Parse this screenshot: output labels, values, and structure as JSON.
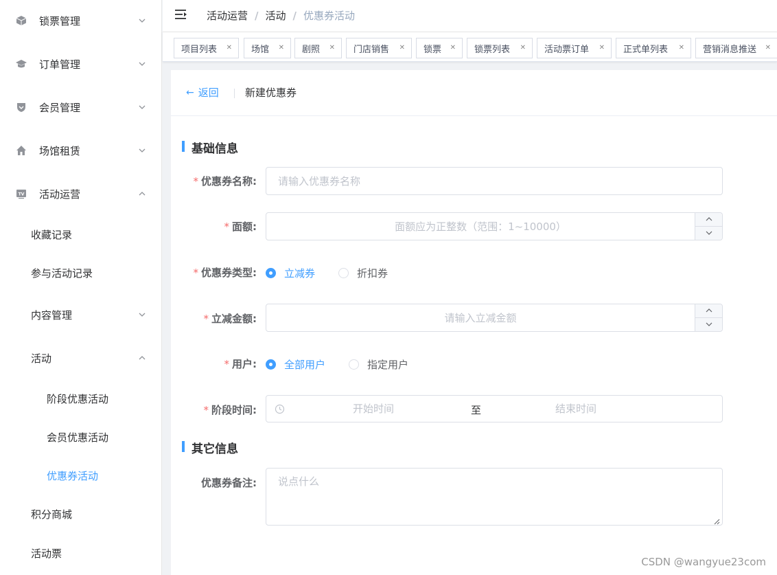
{
  "sidebar": {
    "items": [
      {
        "label": "锁票管理",
        "icon": "cube-icon",
        "expanded": false
      },
      {
        "label": "订单管理",
        "icon": "graduation-cap-icon",
        "expanded": false
      },
      {
        "label": "会员管理",
        "icon": "shield-icon",
        "expanded": false
      },
      {
        "label": "场馆租赁",
        "icon": "home-icon",
        "expanded": false
      },
      {
        "label": "活动运营",
        "icon": "tv-icon",
        "expanded": true
      },
      {
        "label": "收藏记录"
      },
      {
        "label": "参与活动记录"
      },
      {
        "label": "内容管理",
        "expanded": false
      },
      {
        "label": "活动",
        "expanded": true
      },
      {
        "label": "阶段优惠活动"
      },
      {
        "label": "会员优惠活动"
      },
      {
        "label": "优惠券活动",
        "active": true
      },
      {
        "label": "积分商城"
      },
      {
        "label": "活动票"
      }
    ]
  },
  "header": {
    "breadcrumb": [
      "活动运营",
      "活动",
      "优惠券活动"
    ]
  },
  "tags": [
    "项目列表",
    "场馆",
    "剧照",
    "门店销售",
    "锁票",
    "锁票列表",
    "活动票订单",
    "正式单列表",
    "营销消息推送"
  ],
  "page": {
    "back_label": "返回",
    "subtitle": "新建优惠券"
  },
  "form": {
    "section_basic": "基础信息",
    "section_other": "其它信息",
    "name": {
      "label": "优惠券名称:",
      "placeholder": "请输入优惠券名称"
    },
    "amount": {
      "label": "面额:",
      "placeholder": "面额应为正整数（范围：1~10000）"
    },
    "type": {
      "label": "优惠券类型:",
      "options": [
        "立减券",
        "折扣券"
      ],
      "selected": "立减券"
    },
    "reduce": {
      "label": "立减金额:",
      "placeholder": "请输入立减金额"
    },
    "users": {
      "label": "用户:",
      "options": [
        "全部用户",
        "指定用户"
      ],
      "selected": "全部用户"
    },
    "period": {
      "label": "阶段时间:",
      "start_placeholder": "开始时间",
      "separator": "至",
      "end_placeholder": "结束时间"
    },
    "remark": {
      "label": "优惠券备注:",
      "placeholder": "说点什么"
    }
  },
  "watermark": "CSDN @wangyue23com",
  "colors": {
    "accent": "#409eff",
    "required": "#f56c6c"
  }
}
